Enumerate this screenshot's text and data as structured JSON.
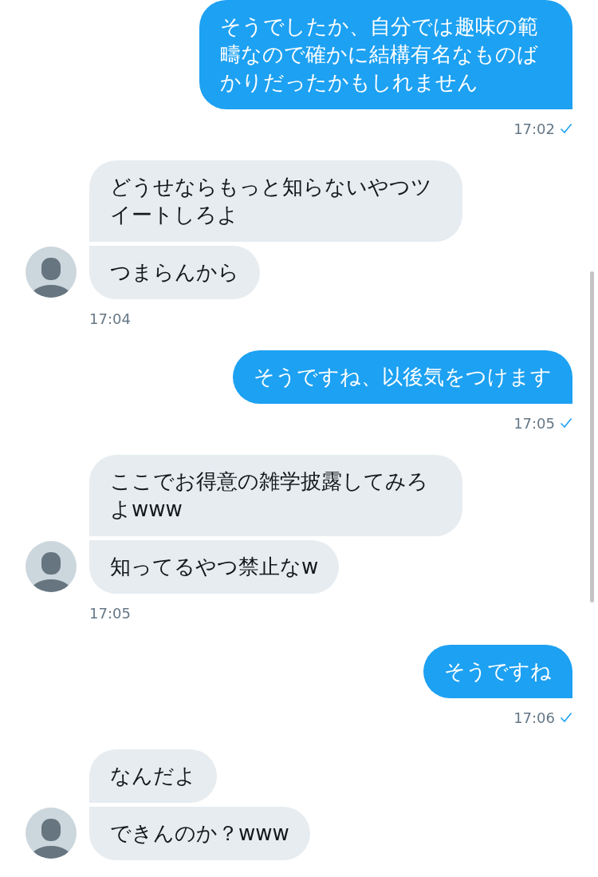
{
  "messages": [
    {
      "kind": "outgoing",
      "bubbles": [
        "そうでしたか、自分では趣味の範疇なので確かに結構有名なものばかりだったかもしれません"
      ],
      "time": "17:02",
      "read": true
    },
    {
      "kind": "incoming",
      "bubbles": [
        "どうせならもっと知らないやつツイートしろよ",
        "つまらんから"
      ],
      "time": "17:04"
    },
    {
      "kind": "outgoing",
      "bubbles": [
        "そうですね、以後気をつけます"
      ],
      "time": "17:05",
      "read": true
    },
    {
      "kind": "incoming",
      "bubbles": [
        "ここでお得意の雑学披露してみろよwww",
        "知ってるやつ禁止なw"
      ],
      "time": "17:05"
    },
    {
      "kind": "outgoing",
      "bubbles": [
        "そうですね"
      ],
      "time": "17:06",
      "read": true
    },
    {
      "kind": "incoming",
      "bubbles": [
        "なんだよ",
        "できんのか？www"
      ]
    }
  ]
}
